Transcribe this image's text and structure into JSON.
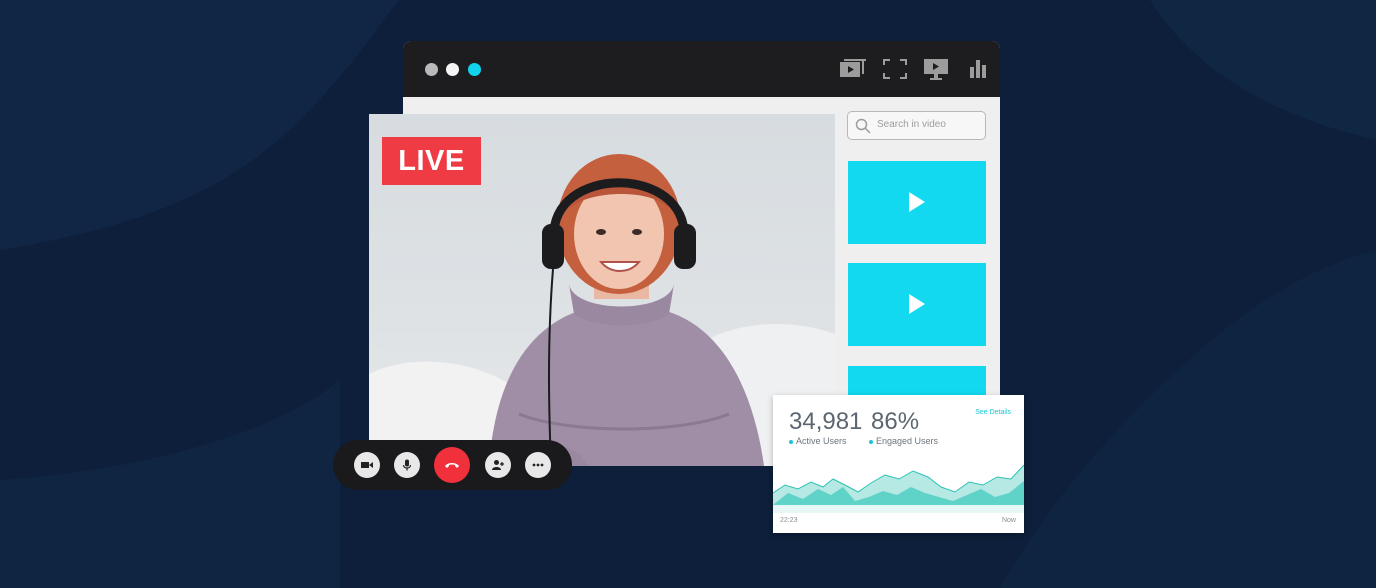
{
  "window": {
    "title_dots": [
      "close",
      "minimize",
      "maximize"
    ],
    "toolbar_icons": [
      "video-gallery-icon",
      "fullscreen-icon",
      "screen-share-icon",
      "analytics-icon"
    ]
  },
  "search": {
    "placeholder": "Search in video"
  },
  "video": {
    "live_badge": "LIVE",
    "thumbnails_count_visible": 3
  },
  "call_controls": {
    "buttons": [
      "camera-icon",
      "microphone-icon",
      "end-call-icon",
      "add-participant-icon",
      "more-options-icon"
    ]
  },
  "stats": {
    "active_users_value": "34,981",
    "active_users_label": "Active Users",
    "engaged_users_value": "86%",
    "engaged_users_label": "Engaged Users",
    "see_details": "See Details",
    "x_start": "22:23",
    "x_end": "Now"
  },
  "colors": {
    "accent": "#12d9ef",
    "live": "#ef3b44",
    "end_call": "#f0313c",
    "background": "#0d1f3a",
    "titlebar": "#1d1d1f"
  }
}
